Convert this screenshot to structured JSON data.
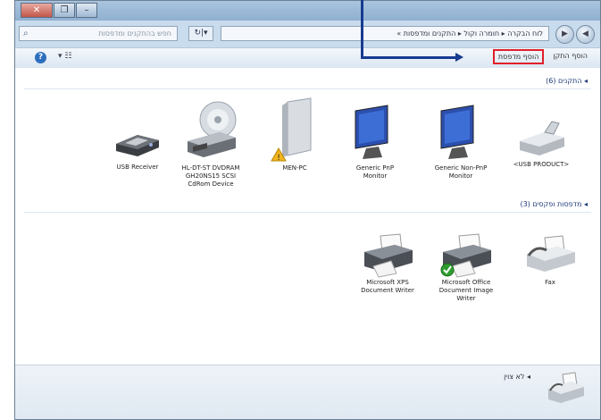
{
  "window": {
    "title_buttons": [
      "✕",
      "❐",
      "–"
    ],
    "search_placeholder": "חפש בהתקנים ומדפסות",
    "refresh_label": "↻|▾",
    "address_path": "« לוח הבקרה ▸ חומרה וקול ▸ התקנים ומדפסות",
    "nav_back": "◀",
    "nav_forward": "▶"
  },
  "toolbar": {
    "help": "?",
    "view": "▾ ☷",
    "add_device": "הוסף התקן",
    "add_printer": "הוסף מדפסת"
  },
  "groups": {
    "devices_header": "◂ התקנים (6)",
    "printers_header": "◂ מדפסות ופקסים (3)",
    "unspecified_header": "◂ לא צוין"
  },
  "devices": [
    {
      "label": "USB Receiver",
      "icon": "usb-receiver-icon"
    },
    {
      "label": "HL-DT-ST DVDRAM GH20NS15 SCSI CdRom Device",
      "icon": "dvd-drive-icon"
    },
    {
      "label": "MEN-PC",
      "icon": "computer-tower-icon"
    },
    {
      "label": "Generic PnP Monitor",
      "icon": "monitor-icon"
    },
    {
      "label": "Generic Non-PnP Monitor",
      "icon": "monitor-icon"
    },
    {
      "label": "<USB PRODUCT>",
      "icon": "usb-device-icon"
    }
  ],
  "printers": [
    {
      "label": "Microsoft XPS Document Writer",
      "icon": "printer-icon"
    },
    {
      "label": "Microsoft Office Document Image Writer",
      "icon": "printer-default-icon"
    },
    {
      "label": "Fax",
      "icon": "fax-icon"
    }
  ],
  "colors": {
    "accent": "#173b8f",
    "highlight": "#e0202a",
    "group_header": "#1e3a78"
  }
}
